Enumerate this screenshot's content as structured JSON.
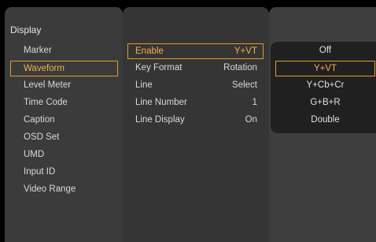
{
  "colors": {
    "accent": "#e59b2a",
    "accent_text": "#f0b14a",
    "panel_left": "#3b3b3b",
    "panel_mid": "#353535",
    "panel_right": "#3e3e3e",
    "popup": "#202020",
    "background": "#000000"
  },
  "main_menu": {
    "title": "Display",
    "items": [
      {
        "label": "Marker",
        "selected": false
      },
      {
        "label": "Waveform",
        "selected": true
      },
      {
        "label": "Level Meter",
        "selected": false
      },
      {
        "label": "Time Code",
        "selected": false
      },
      {
        "label": "Caption",
        "selected": false
      },
      {
        "label": "OSD Set",
        "selected": false
      },
      {
        "label": "UMD",
        "selected": false
      },
      {
        "label": "Input ID",
        "selected": false
      },
      {
        "label": "Video Range",
        "selected": false
      }
    ]
  },
  "submenu": {
    "items": [
      {
        "label": "Enable",
        "value": "Y+VT",
        "selected": true
      },
      {
        "label": "Key Format",
        "value": "Rotation",
        "selected": false
      },
      {
        "label": "Line",
        "value": "Select",
        "selected": false
      },
      {
        "label": "Line Number",
        "value": "1",
        "selected": false
      },
      {
        "label": "Line Display",
        "value": "On",
        "selected": false
      }
    ]
  },
  "options": {
    "items": [
      {
        "label": "Off",
        "selected": false
      },
      {
        "label": "Y+VT",
        "selected": true
      },
      {
        "label": "Y+Cb+Cr",
        "selected": false
      },
      {
        "label": "G+B+R",
        "selected": false
      },
      {
        "label": "Double",
        "selected": false
      }
    ]
  }
}
